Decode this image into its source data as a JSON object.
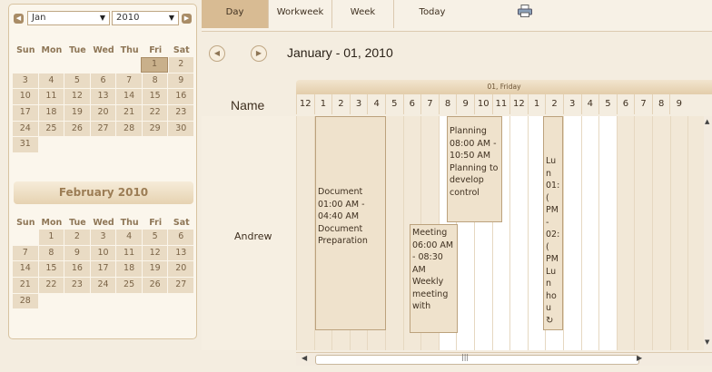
{
  "calendar": {
    "month_value": "Jan",
    "year_value": "2010",
    "weekdays": [
      "Sun",
      "Mon",
      "Tue",
      "Wed",
      "Thu",
      "Fri",
      "Sat"
    ],
    "jan_weeks": [
      [
        "",
        "",
        "",
        "",
        "",
        "1",
        "2"
      ],
      [
        "3",
        "4",
        "5",
        "6",
        "7",
        "8",
        "9"
      ],
      [
        "10",
        "11",
        "12",
        "13",
        "14",
        "15",
        "16"
      ],
      [
        "17",
        "18",
        "19",
        "20",
        "21",
        "22",
        "23"
      ],
      [
        "24",
        "25",
        "26",
        "27",
        "28",
        "29",
        "30"
      ],
      [
        "31",
        "",
        "",
        "",
        "",
        "",
        ""
      ]
    ],
    "feb_title": "February 2010",
    "feb_weeks": [
      [
        "",
        "1",
        "2",
        "3",
        "4",
        "5",
        "6"
      ],
      [
        "7",
        "8",
        "9",
        "10",
        "11",
        "12",
        "13"
      ],
      [
        "14",
        "15",
        "16",
        "17",
        "18",
        "19",
        "20"
      ],
      [
        "21",
        "22",
        "23",
        "24",
        "25",
        "26",
        "27"
      ],
      [
        "28",
        "",
        "",
        "",
        "",
        "",
        ""
      ]
    ]
  },
  "toolbar": {
    "day": "Day",
    "workweek": "Workweek",
    "week": "Week",
    "today": "Today",
    "print_icon": "printer-icon"
  },
  "header": {
    "date_title": "January - 01, 2010"
  },
  "scheduler": {
    "day_label": "01, Friday",
    "name_label": "Name",
    "resource": "Andrew",
    "hours": [
      "12",
      "1",
      "2",
      "3",
      "4",
      "5",
      "6",
      "7",
      "8",
      "9",
      "10",
      "11",
      "12",
      "1",
      "2",
      "3",
      "4",
      "5",
      "6",
      "7",
      "8",
      "9"
    ],
    "events": [
      {
        "title": "Document",
        "time": "01:00 AM - 04:40 AM",
        "desc": "Document Preparation"
      },
      {
        "title": "Meeting",
        "time": "06:00 AM - 08:30 AM",
        "desc": "Weekly meeting with"
      },
      {
        "title": "Planning",
        "time": "08:00 AM - 10:50 AM",
        "desc": "Planning to develop control"
      },
      {
        "title": "Lun",
        "time": "01:( PM - 02:( PM",
        "desc": "Lun hou"
      }
    ]
  },
  "colors": {
    "accent": "#d8bb93",
    "event_bg": "#efe2cc",
    "panel_bg": "#fbf6ec"
  }
}
